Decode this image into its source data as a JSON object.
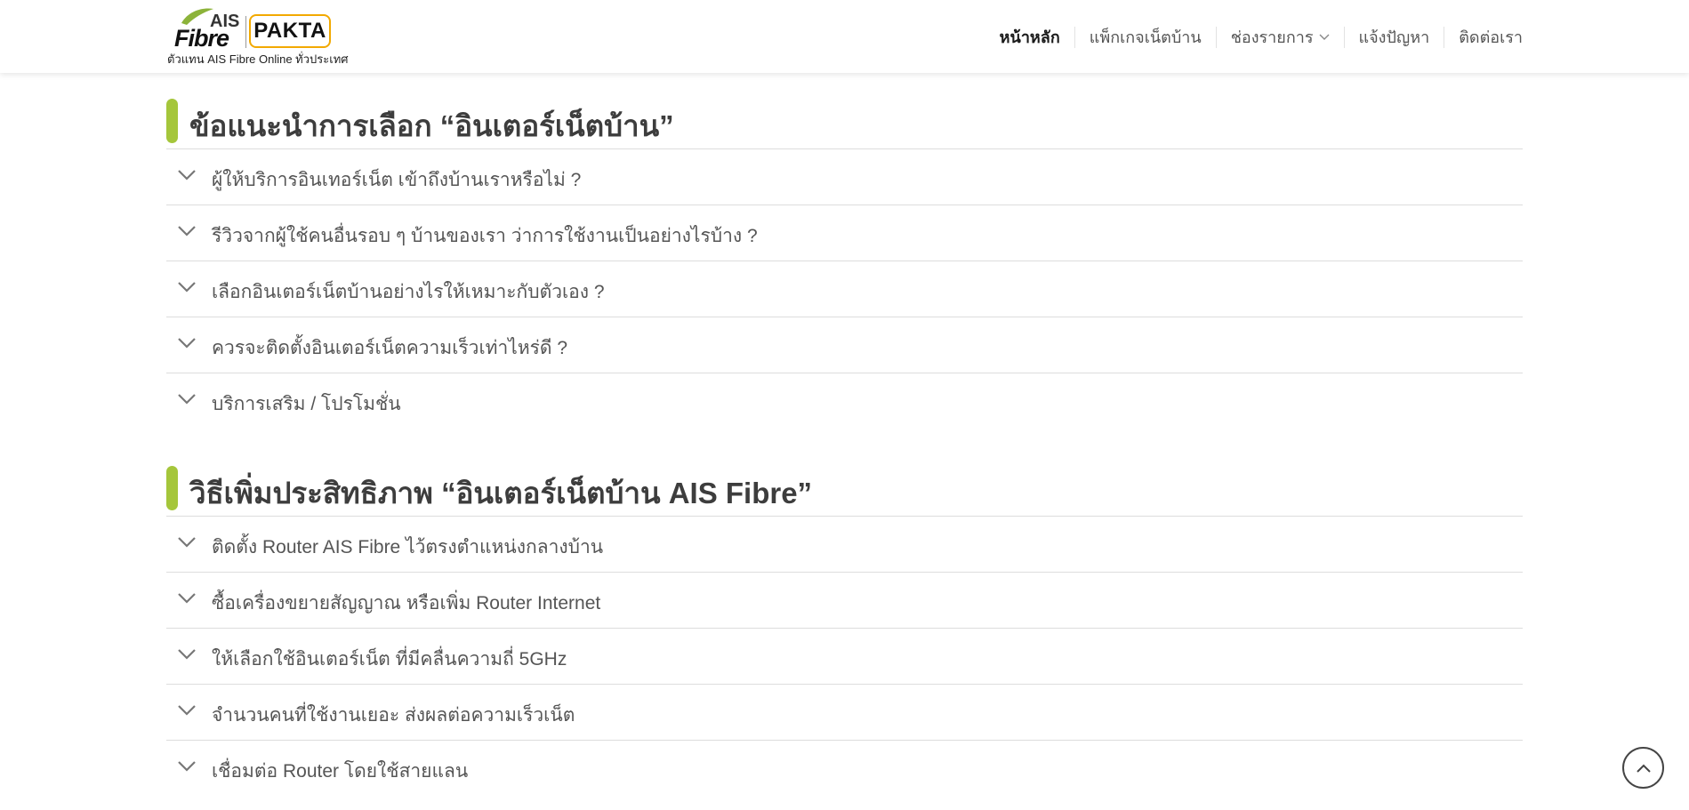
{
  "brand": {
    "logo_ais": "AIS",
    "logo_fibre": "Fibre",
    "logo_pakta": "PAKTA",
    "tagline": "ตัวแทน AIS Fibre Online ทั่วประเทศ",
    "accent_green": "#a5c63b",
    "accent_orange": "#f2a900"
  },
  "nav": {
    "items": [
      {
        "label": "หน้าหลัก",
        "active": true
      },
      {
        "label": "แพ็กเกจเน็ตบ้าน"
      },
      {
        "label": "ช่องรายการ",
        "icon": "chevron-down-icon"
      },
      {
        "label": "แจ้งปัญหา"
      },
      {
        "label": "ติดต่อเรา"
      }
    ]
  },
  "sections": [
    {
      "title": "ข้อแนะนำการเลือก “อินเตอร์เน็ตบ้าน”",
      "items": [
        "ผู้ให้บริการอินเทอร์เน็ต เข้าถึงบ้านเราหรือไม่ ?",
        "รีวิวจากผู้ใช้คนอื่นรอบ ๆ บ้านของเรา ว่าการใช้งานเป็นอย่างไรบ้าง ?",
        "เลือกอินเตอร์เน็ตบ้านอย่างไรให้เหมาะกับตัวเอง ?",
        "ควรจะติดตั้งอินเตอร์เน็ตความเร็วเท่าไหร่ดี ?",
        "บริการเสริม / โปรโมชั่น"
      ]
    },
    {
      "title": "วิธีเพิ่มประสิทธิภาพ “อินเตอร์เน็ตบ้าน AIS Fibre”",
      "items": [
        "ติดตั้ง Router AIS Fibre ไว้ตรงตำแหน่งกลางบ้าน",
        "ซื้อเครื่องขยายสัญญาณ หรือเพิ่ม Router Internet",
        "ให้เลือกใช้อินเตอร์เน็ต ที่มีคลื่นความถี่ 5GHz",
        "จำนวนคนที่ใช้งานเยอะ ส่งผลต่อความเร็วเน็ต",
        "เชื่อมต่อ Router โดยใช้สายแลน"
      ]
    }
  ],
  "icons": {
    "accordion": "chevron-down-icon",
    "back_to_top": "chevron-up-icon"
  }
}
